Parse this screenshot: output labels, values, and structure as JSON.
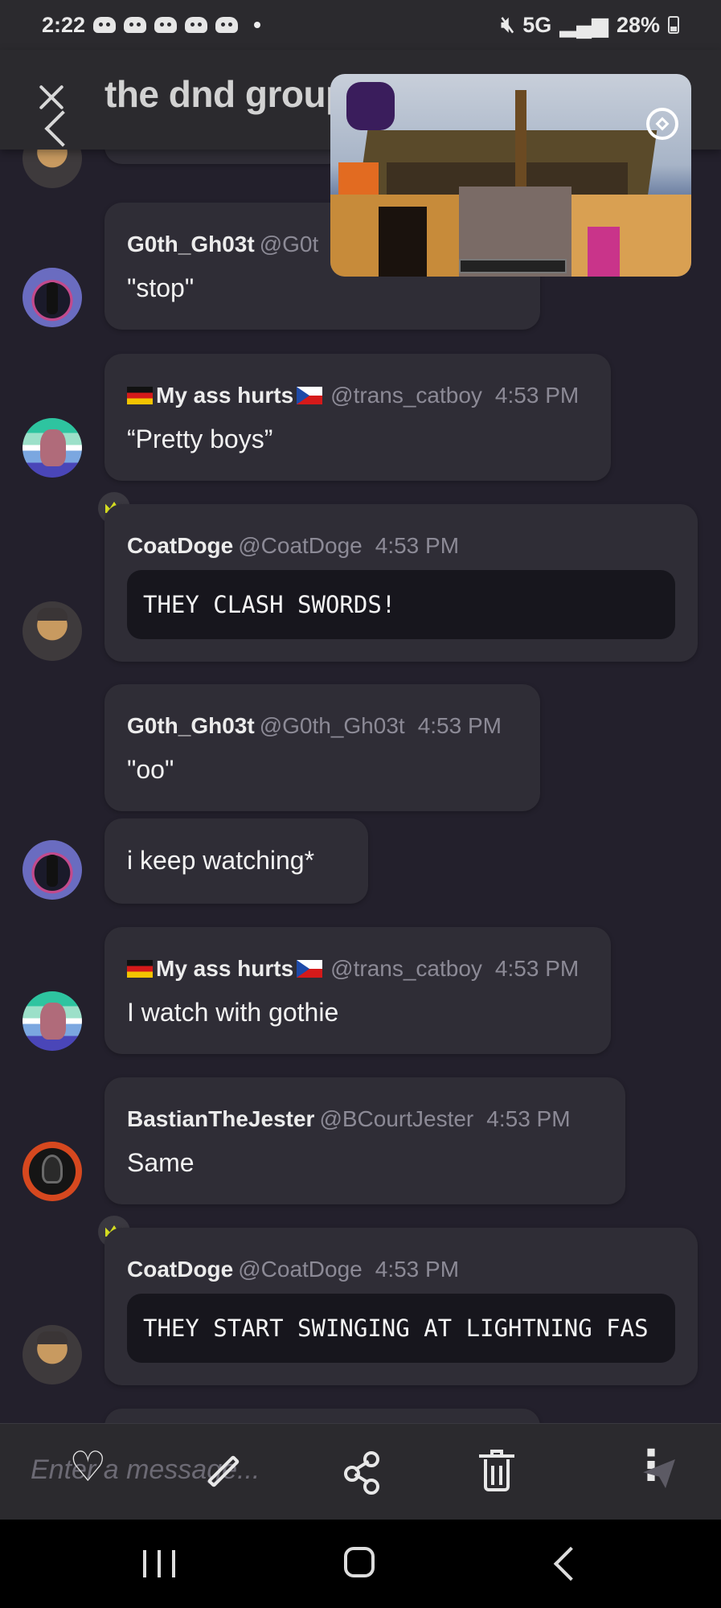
{
  "status_bar": {
    "time": "2:22",
    "network": "5G",
    "battery": "28%"
  },
  "header": {
    "title": "the dnd group"
  },
  "messages": [
    {
      "name": "G0th_Gh03t",
      "handle": "@G0t",
      "time": "",
      "text": "\"stop\""
    },
    {
      "name": "My ass hurts",
      "handle": "@trans_catboy",
      "time": "4:53 PM",
      "text": "“Pretty boys”"
    },
    {
      "name": "CoatDoge",
      "handle": "@CoatDoge",
      "time": "4:53 PM",
      "code": "THEY CLASH SWORDS!"
    },
    {
      "name": "G0th_Gh03t",
      "handle": "@G0th_Gh03t",
      "time": "4:53 PM",
      "text": "\"oo\""
    },
    {
      "text": "i keep watching*"
    },
    {
      "name": "My ass hurts",
      "handle": "@trans_catboy",
      "time": "4:53 PM",
      "text": "I watch with gothie"
    },
    {
      "name": "BastianTheJester",
      "handle": "@BCourtJester",
      "time": "4:53 PM",
      "text": "Same"
    },
    {
      "name": "CoatDoge",
      "handle": "@CoatDoge",
      "time": "4:53 PM",
      "code": "THEY START SWINGING AT LIGHTNING FAS"
    }
  ],
  "composer": {
    "placeholder": "Enter a message..."
  },
  "icons": {
    "heart": "heart-icon",
    "pencil": "pencil-icon",
    "share": "share-icon",
    "trash": "trash-icon",
    "more": "more-icon",
    "send": "send-icon"
  }
}
